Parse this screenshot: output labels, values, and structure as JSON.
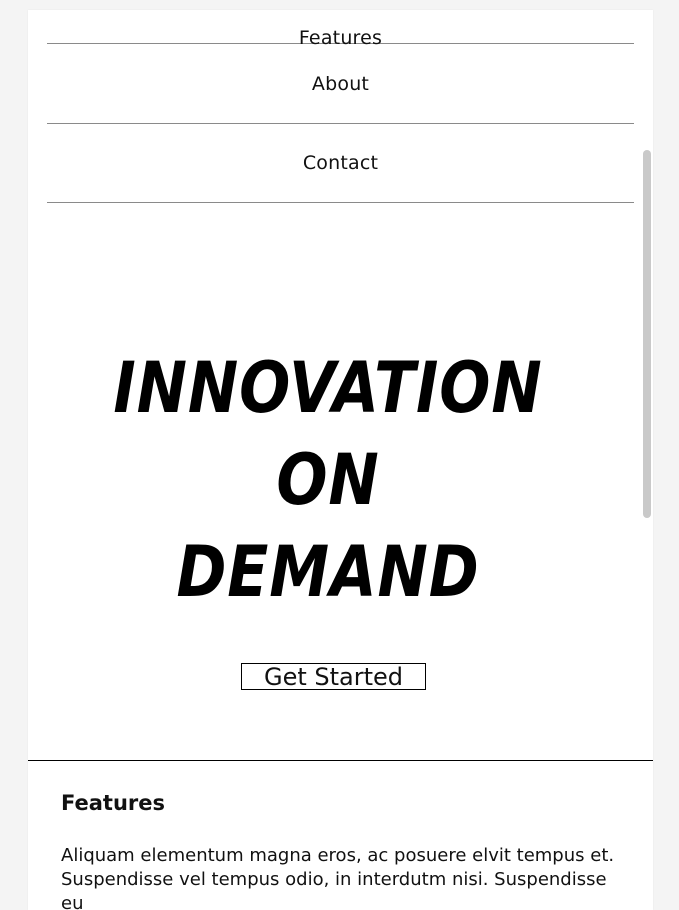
{
  "nav": {
    "items": [
      {
        "label": "Features"
      },
      {
        "label": "About"
      },
      {
        "label": "Contact"
      }
    ]
  },
  "hero": {
    "title_lines": [
      "INNOVATION",
      "ON",
      "DEMAND"
    ],
    "cta_label": "Get Started"
  },
  "features": {
    "title": "Features",
    "text": "Aliquam elementum magna eros, ac posuere elvit tempus et. Suspendisse vel tempus odio, in interdutm nisi. Suspendisse eu"
  },
  "colors": {
    "background": "#f4f4f4",
    "card": "#ffffff",
    "divider": "#8a8a8a",
    "text": "#111111",
    "scroll_thumb": "#c9c9c9"
  }
}
